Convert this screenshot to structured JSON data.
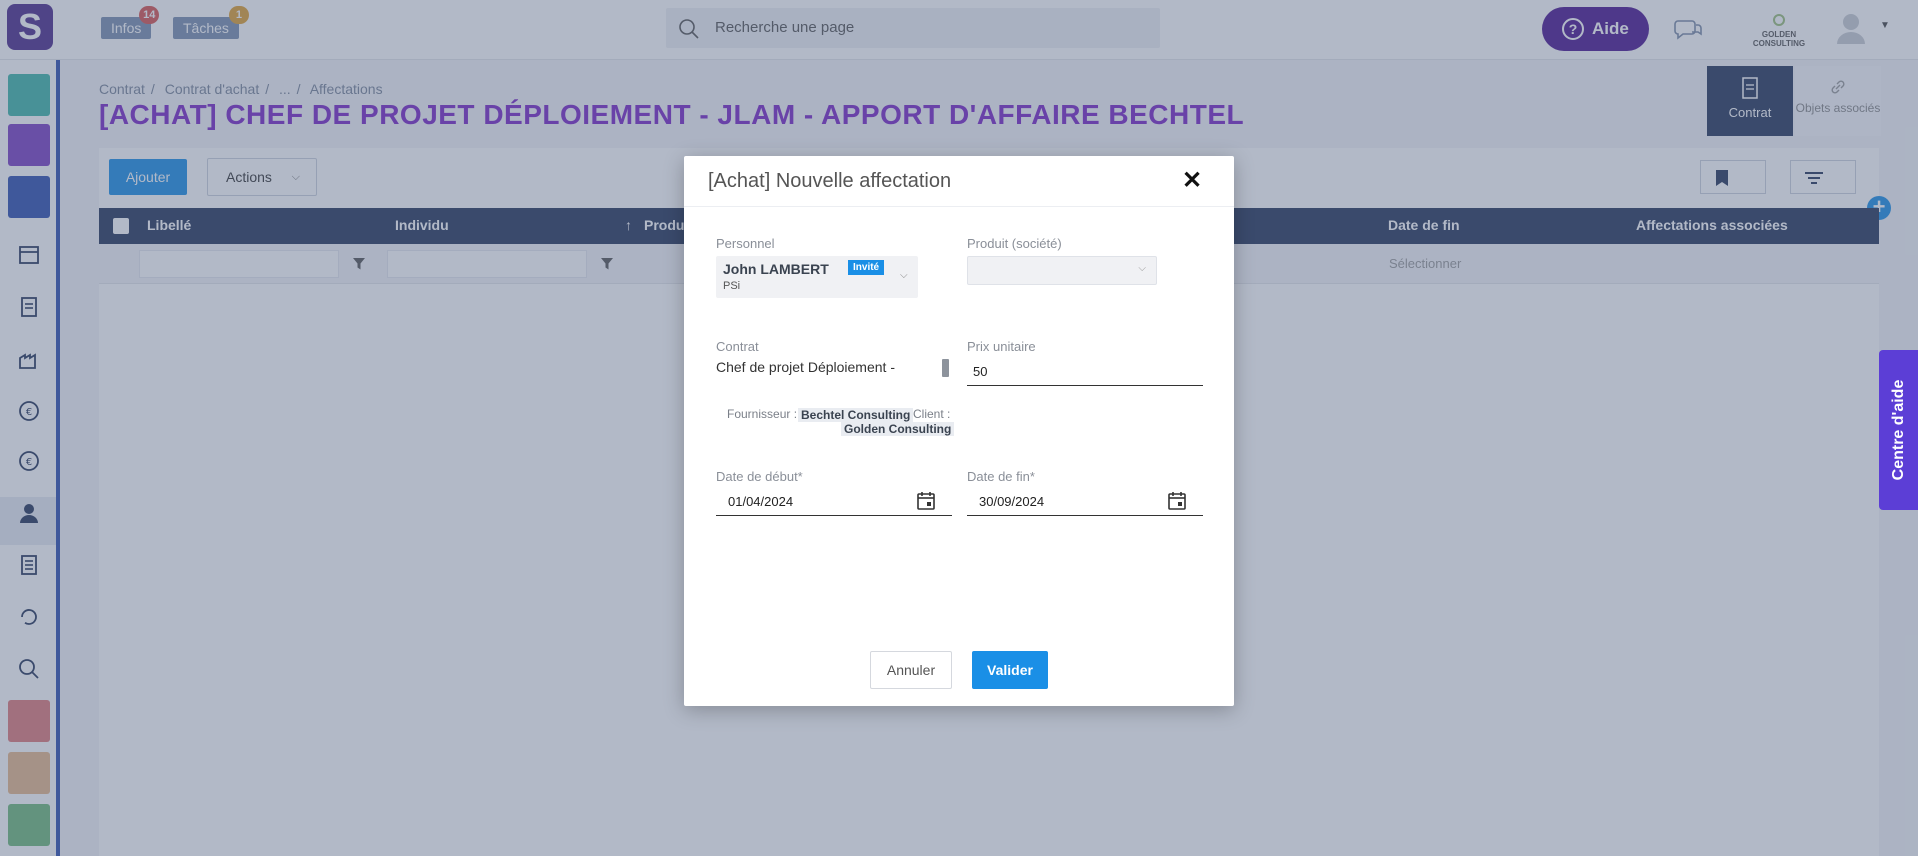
{
  "header": {
    "logo_letter": "S",
    "infos": {
      "label": "Infos",
      "count": "14"
    },
    "taches": {
      "label": "Tâches",
      "count": "1"
    },
    "search_placeholder": "Recherche une page",
    "help_label": "Aide",
    "company_name": "GOLDEN CONSULTING"
  },
  "breadcrumb": [
    "Contrat",
    "Contrat d'achat",
    "...",
    "Affectations"
  ],
  "page_title": "[ACHAT] CHEF DE PROJET DÉPLOIEMENT - JLAM - APPORT D'AFFAIRE BECHTEL",
  "tabs": {
    "contrat": "Contrat",
    "objets": "Objets associés"
  },
  "toolbar": {
    "add_label": "Ajouter",
    "actions_label": "Actions"
  },
  "table": {
    "columns": [
      "Libellé",
      "Individu",
      "Produit",
      "Date de fin",
      "Affectations associées"
    ],
    "sort_indicator": "↑",
    "filter_placeholder": "Sélectionner"
  },
  "help_center": "Centre d'aide",
  "modal": {
    "title": "[Achat] Nouvelle affectation",
    "personnel_label": "Personnel",
    "personnel_name": "John LAMBERT",
    "personnel_tag": "Invité",
    "personnel_sub": "PSi",
    "produit_label": "Produit (société)",
    "contrat_label": "Contrat",
    "contrat_value": "Chef de projet Déploiement - JLAM - Apport d'affaire BECHTEL",
    "fournisseur_label": "Fournisseur :",
    "fournisseur_value": "Bechtel Consulting",
    "client_label": "Client :",
    "client_value": "Golden Consulting",
    "prix_label": "Prix unitaire",
    "prix_value": "50",
    "date_debut_label": "Date de début*",
    "date_debut_value": "01/04/2024",
    "date_fin_label": "Date de fin*",
    "date_fin_value": "30/09/2024",
    "cancel_label": "Annuler",
    "ok_label": "Valider"
  },
  "colors": {
    "accent": "#1a8fe6",
    "title_purple": "#7b27c7",
    "help_purple": "#4a1590",
    "table_header": "#26355a"
  }
}
